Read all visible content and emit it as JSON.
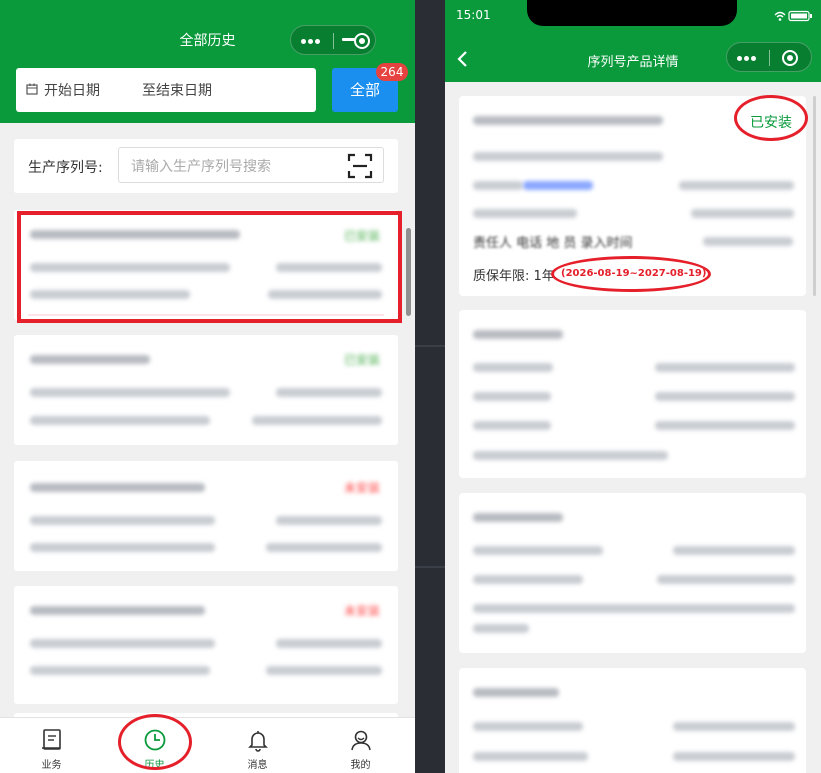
{
  "left": {
    "header": {
      "title": "全部历史"
    },
    "filter": {
      "start_placeholder": "开始日期",
      "separator": "至",
      "end_placeholder": "结束日期",
      "all_button": "全部",
      "badge_count": "264"
    },
    "serial": {
      "label": "生产序列号:",
      "placeholder": "请输入生产序列号搜索"
    },
    "records": [
      {
        "status_color": "green"
      },
      {
        "status_color": "green"
      },
      {
        "status_color": "red"
      },
      {
        "status_color": "red"
      }
    ],
    "tabbar": [
      {
        "label": "业务",
        "icon": "book-icon"
      },
      {
        "label": "历史",
        "icon": "clock-icon",
        "active": true
      },
      {
        "label": "消息",
        "icon": "bell-icon"
      },
      {
        "label": "我的",
        "icon": "user-icon"
      }
    ]
  },
  "right": {
    "status_bar": {
      "time": "15:01"
    },
    "header": {
      "title": "序列号产品详情"
    },
    "detail": {
      "status": "已安装",
      "partial_line": "责任人 电话 地 员   录入时间",
      "warranty_label": "质保年限: 1年",
      "warranty_range": "(2026-08-19~2027-08-19)"
    }
  },
  "colors": {
    "brand_green": "#0a9a3c",
    "button_blue": "#1a8ff0",
    "badge_red": "#e64340",
    "annotation_red": "#e5202b"
  }
}
